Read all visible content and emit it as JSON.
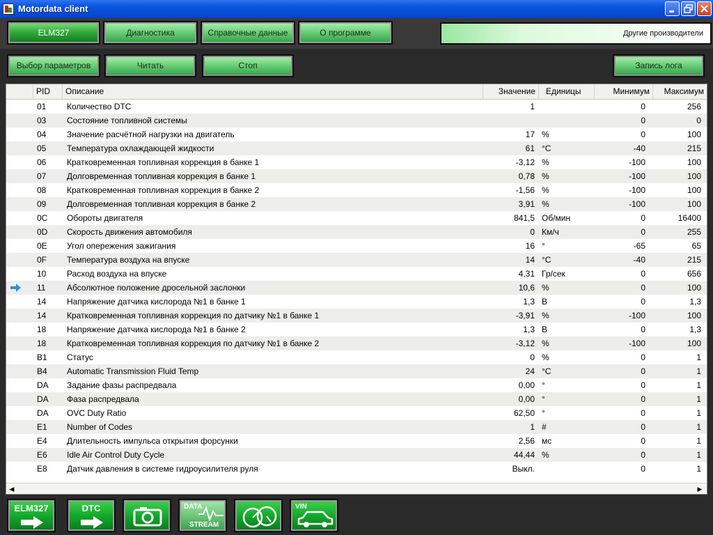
{
  "window": {
    "title": "Motordata client"
  },
  "menu": {
    "tabs": [
      "ELM327",
      "Диагностика",
      "Справочные данные",
      "О программе"
    ],
    "other_makers": "Другие производители"
  },
  "toolbar": {
    "select_params": "Выбор параметров",
    "read": "Читать",
    "stop": "Стоп",
    "log": "Запись лога"
  },
  "table": {
    "headers": {
      "pid": "PID",
      "desc": "Описание",
      "value": "Значение",
      "unit": "Единицы",
      "min": "Минимум",
      "max": "Максимум"
    },
    "selected_row_index": 13,
    "rows": [
      {
        "pid": "01",
        "desc": "Количество DTC",
        "value": "1",
        "unit": "",
        "min": "0",
        "max": "256"
      },
      {
        "pid": "03",
        "desc": "Состояние топливной системы",
        "value": "",
        "unit": "",
        "min": "0",
        "max": "0"
      },
      {
        "pid": "04",
        "desc": "Значение расчётной нагрузки на двигатель",
        "value": "17",
        "unit": "%",
        "min": "0",
        "max": "100"
      },
      {
        "pid": "05",
        "desc": "Температура охлаждающей жидкости",
        "value": "61",
        "unit": "°C",
        "min": "-40",
        "max": "215"
      },
      {
        "pid": "06",
        "desc": "Кратковременная топливная коррекция в банке 1",
        "value": "-3,12",
        "unit": "%",
        "min": "-100",
        "max": "100"
      },
      {
        "pid": "07",
        "desc": "Долговременная топливная коррекция в банке 1",
        "value": "0,78",
        "unit": "%",
        "min": "-100",
        "max": "100"
      },
      {
        "pid": "08",
        "desc": "Кратковременная топливная коррекция в банке 2",
        "value": "-1,56",
        "unit": "%",
        "min": "-100",
        "max": "100"
      },
      {
        "pid": "09",
        "desc": "Долговременная топливная коррекция в банке 2",
        "value": "3,91",
        "unit": "%",
        "min": "-100",
        "max": "100"
      },
      {
        "pid": "0C",
        "desc": "Обороты двигателя",
        "value": "841,5",
        "unit": "Об/мин",
        "min": "0",
        "max": "16400"
      },
      {
        "pid": "0D",
        "desc": "Скорость движения автомобиля",
        "value": "0",
        "unit": "Км/ч",
        "min": "0",
        "max": "255"
      },
      {
        "pid": "0E",
        "desc": "Угол опережения зажигания",
        "value": "16",
        "unit": "°",
        "min": "-65",
        "max": "65"
      },
      {
        "pid": "0F",
        "desc": "Температура воздуха на впуске",
        "value": "14",
        "unit": "°C",
        "min": "-40",
        "max": "215"
      },
      {
        "pid": "10",
        "desc": "Расход воздуха на впуске",
        "value": "4,31",
        "unit": "Гр/сек",
        "min": "0",
        "max": "656"
      },
      {
        "pid": "11",
        "desc": "Абсолютное положение дросельной заслонки",
        "value": "10,6",
        "unit": "%",
        "min": "0",
        "max": "100"
      },
      {
        "pid": "14",
        "desc": "Напряжение датчика кислорода №1 в банке 1",
        "value": "1,3",
        "unit": "В",
        "min": "0",
        "max": "1,3"
      },
      {
        "pid": "14",
        "desc": "Кратковременная топливная коррекция по датчику №1 в банке 1",
        "value": "-3,91",
        "unit": "%",
        "min": "-100",
        "max": "100"
      },
      {
        "pid": "18",
        "desc": "Напряжение датчика кислорода №1 в банке 2",
        "value": "1,3",
        "unit": "В",
        "min": "0",
        "max": "1,3"
      },
      {
        "pid": "18",
        "desc": "Кратковременная топливная коррекция по датчику №1 в банке 2",
        "value": "-3,12",
        "unit": "%",
        "min": "-100",
        "max": "100"
      },
      {
        "pid": "B1",
        "desc": "Статус",
        "value": "0",
        "unit": "%",
        "min": "0",
        "max": "1"
      },
      {
        "pid": "B4",
        "desc": "Automatic Transmission Fluid Temp",
        "value": "24",
        "unit": "°C",
        "min": "0",
        "max": "1"
      },
      {
        "pid": "DA",
        "desc": "Задание фазы распредвала",
        "value": "0,00",
        "unit": "°",
        "min": "0",
        "max": "1"
      },
      {
        "pid": "DA",
        "desc": "Фаза распредвала",
        "value": "0,00",
        "unit": "°",
        "min": "0",
        "max": "1"
      },
      {
        "pid": "DA",
        "desc": "OVC Duty Ratio",
        "value": "62,50",
        "unit": "°",
        "min": "0",
        "max": "1"
      },
      {
        "pid": "E1",
        "desc": "Number of Codes",
        "value": "1",
        "unit": "#",
        "min": "0",
        "max": "1"
      },
      {
        "pid": "E4",
        "desc": "Длительность импульса открытия форсунки",
        "value": "2,56",
        "unit": "мс",
        "min": "0",
        "max": "1"
      },
      {
        "pid": "E6",
        "desc": "Idle Air Control Duty Cycle",
        "value": "44,44",
        "unit": "%",
        "min": "0",
        "max": "1"
      },
      {
        "pid": "E8",
        "desc": "Датчик давления в системе гидроусилителя руля",
        "value": "Выкл.",
        "unit": "",
        "min": "0",
        "max": "1"
      }
    ]
  },
  "bottom": {
    "elm_label": "ELM327",
    "dtc_label": "DTC",
    "data_label": "DATA",
    "stream_label": "STREAM",
    "vin_label": "VIN",
    "icons": [
      "arrow-right-icon",
      "camera-icon",
      "data-stream-icon",
      "gauge-icon",
      "car-icon"
    ]
  },
  "colors": {
    "green_button": "#6ed07a",
    "green_dark": "#12a42a",
    "row_alt": "#ededeb",
    "arrow_blue": "#2e8fd8",
    "titlebar": "#0a55e0"
  }
}
